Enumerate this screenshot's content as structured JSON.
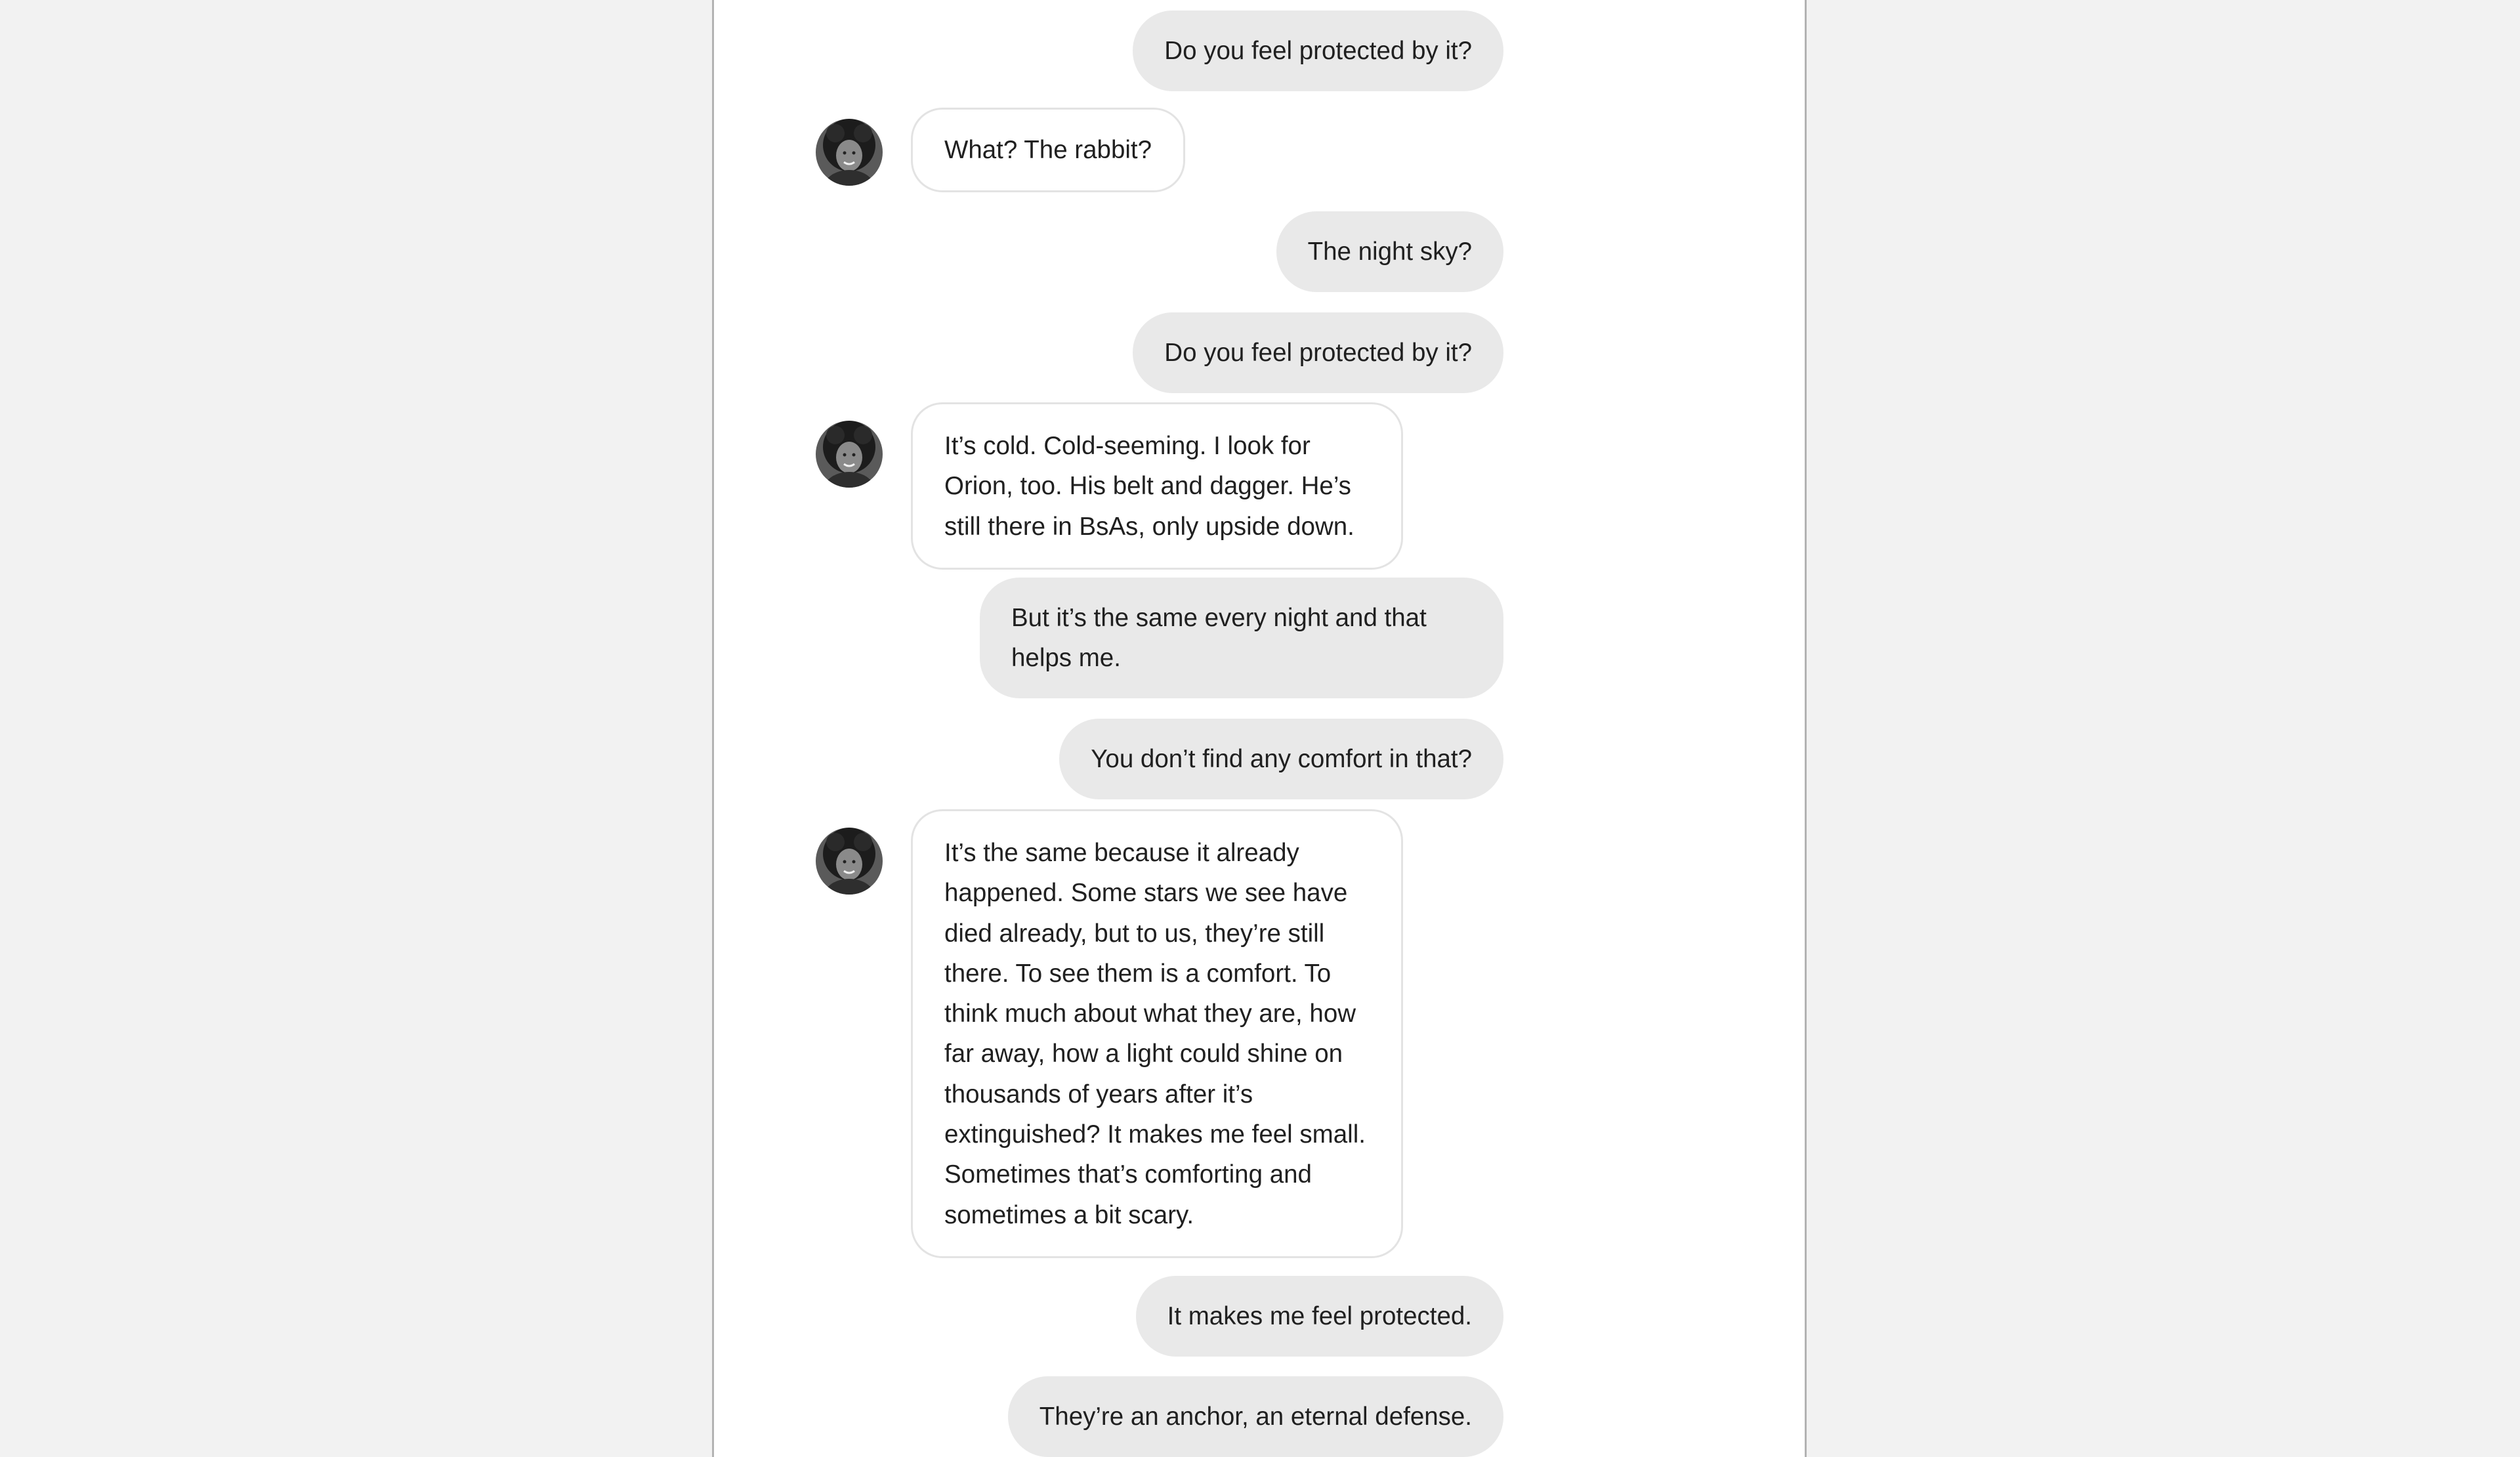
{
  "conversation": {
    "messages": [
      {
        "side": "out",
        "text": "Do you feel protected by it?"
      },
      {
        "side": "in",
        "text": "What? The rabbit?"
      },
      {
        "side": "out",
        "text": "The night sky?"
      },
      {
        "side": "out",
        "text": "Do you feel protected by it?"
      },
      {
        "side": "in",
        "text": "It’s cold. Cold-seeming. I look for Orion, too. His belt and dagger. He’s still there in BsAs, only upside down."
      },
      {
        "side": "out",
        "text": "But it’s the same every night and that helps me."
      },
      {
        "side": "out",
        "text": "You don’t find any comfort in that?"
      },
      {
        "side": "in",
        "text": "It’s the same because it already happened. Some stars we see have died already, but to us, they’re still there. To see them is a comfort. To think much about what they are, how far away, how a light could shine on thousands of years after it’s extinguished? It makes me feel small. Sometimes that’s comforting and sometimes a bit scary."
      },
      {
        "side": "out",
        "text": "It makes me feel protected."
      },
      {
        "side": "out",
        "text": "They’re an anchor, an eternal defense."
      }
    ]
  },
  "colors": {
    "page_background": "#f2f2f2",
    "panel_background": "#ffffff",
    "outgoing_bubble": "#e9e9e9",
    "incoming_border": "#e3e3e3",
    "text": "#202020"
  },
  "icons": {
    "avatar": "contact-avatar-photo"
  }
}
